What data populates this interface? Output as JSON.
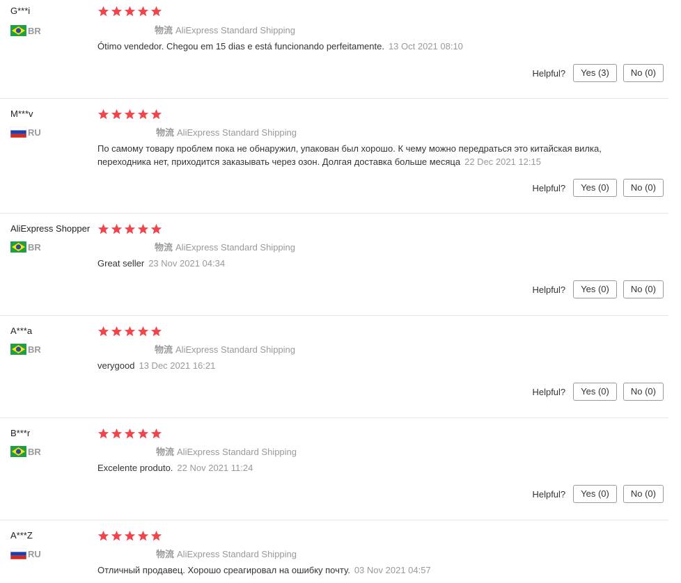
{
  "ui": {
    "helpful_label": "Helpful?",
    "shipping_head": "物流",
    "star_color": "#f2454b",
    "star_icon": "star-icon"
  },
  "reviews": [
    {
      "user": "G***i",
      "country": "BR",
      "flag": "brazil-flag-icon",
      "rating": 5,
      "shipping": "AliExpress Standard Shipping",
      "text": "Ótimo vendedor. Chegou em 15 dias e está funcionando perfeitamente.",
      "date": "13 Oct 2021 08:10",
      "yes": "Yes (3)",
      "no": "No (0)"
    },
    {
      "user": "M***v",
      "country": "RU",
      "flag": "russia-flag-icon",
      "rating": 5,
      "shipping": "AliExpress Standard Shipping",
      "text": "По самому товару проблем пока не обнаружил, упакован был хорошо. К чему можно передраться это китайская вилка, переходника нет, приходится заказывать через озон. Долгая доставка больше месяца",
      "date": "22 Dec 2021 12:15",
      "yes": "Yes (0)",
      "no": "No (0)"
    },
    {
      "user": "AliExpress Shopper",
      "country": "BR",
      "flag": "brazil-flag-icon",
      "rating": 5,
      "shipping": "AliExpress Standard Shipping",
      "text": "Great seller",
      "date": "23 Nov 2021 04:34",
      "yes": "Yes (0)",
      "no": "No (0)"
    },
    {
      "user": "A***a",
      "country": "BR",
      "flag": "brazil-flag-icon",
      "rating": 5,
      "shipping": "AliExpress Standard Shipping",
      "text": "verygood",
      "date": "13 Dec 2021 16:21",
      "yes": "Yes (0)",
      "no": "No (0)"
    },
    {
      "user": "B***r",
      "country": "BR",
      "flag": "brazil-flag-icon",
      "rating": 5,
      "shipping": "AliExpress Standard Shipping",
      "text": "Excelente produto.",
      "date": "22 Nov 2021 11:24",
      "yes": "Yes (0)",
      "no": "No (0)"
    },
    {
      "user": "A***Z",
      "country": "RU",
      "flag": "russia-flag-icon",
      "rating": 5,
      "shipping": "AliExpress Standard Shipping",
      "text": "Отличный продавец. Хорошо среагировал на ошибку почту.",
      "date": "03 Nov 2021 04:57"
    }
  ]
}
